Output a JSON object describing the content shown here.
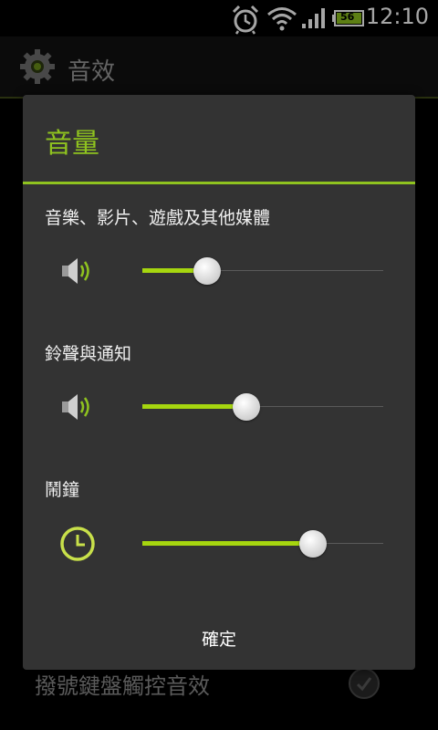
{
  "status_bar": {
    "time": "12:10",
    "battery_level": "56",
    "icons": [
      "alarm-clock-icon",
      "wifi-icon",
      "signal-icon",
      "battery-icon"
    ]
  },
  "activity": {
    "title": "音效",
    "icon": "gear-icon",
    "background_row_label": "撥號鍵盤觸控音效"
  },
  "dialog": {
    "title": "音量",
    "accent_color": "#8fc31f",
    "sliders": [
      {
        "label": "音樂、影片、遊戲及其他媒體",
        "icon": "speaker-icon",
        "level": 0.27
      },
      {
        "label": "鈴聲與通知",
        "icon": "speaker-icon",
        "level": 0.43
      },
      {
        "label": "鬧鐘",
        "icon": "clock-icon",
        "level": 0.71
      }
    ],
    "ok_label": "確定"
  }
}
